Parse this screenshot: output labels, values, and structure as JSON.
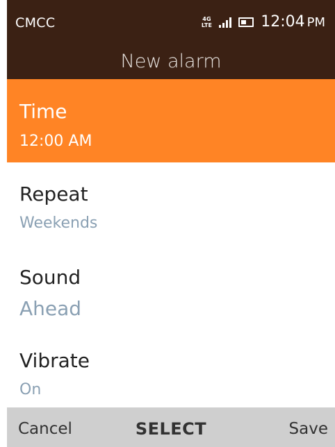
{
  "status_bar": {
    "carrier": "CMCC",
    "network_top": "4G",
    "network_bottom": "LTE",
    "time": "12:04",
    "ampm": "PM",
    "icons": [
      "network-4g-lte-icon",
      "signal-icon",
      "battery-icon"
    ]
  },
  "header": {
    "title": "New alarm"
  },
  "settings": [
    {
      "label": "Time",
      "value": "12:00 AM"
    },
    {
      "label": "Repeat",
      "value": "Weekends"
    },
    {
      "label": "Sound",
      "value": "Ahead"
    },
    {
      "label": "Vibrate",
      "value": "On"
    }
  ],
  "softkeys": {
    "left": "Cancel",
    "center": "SELECT",
    "right": "Save"
  },
  "colors": {
    "header_bg": "#3b2114",
    "focus_bg": "#ff8425",
    "secondary_text": "#8aa0b3",
    "softkey_bg": "#cfcfcf"
  }
}
